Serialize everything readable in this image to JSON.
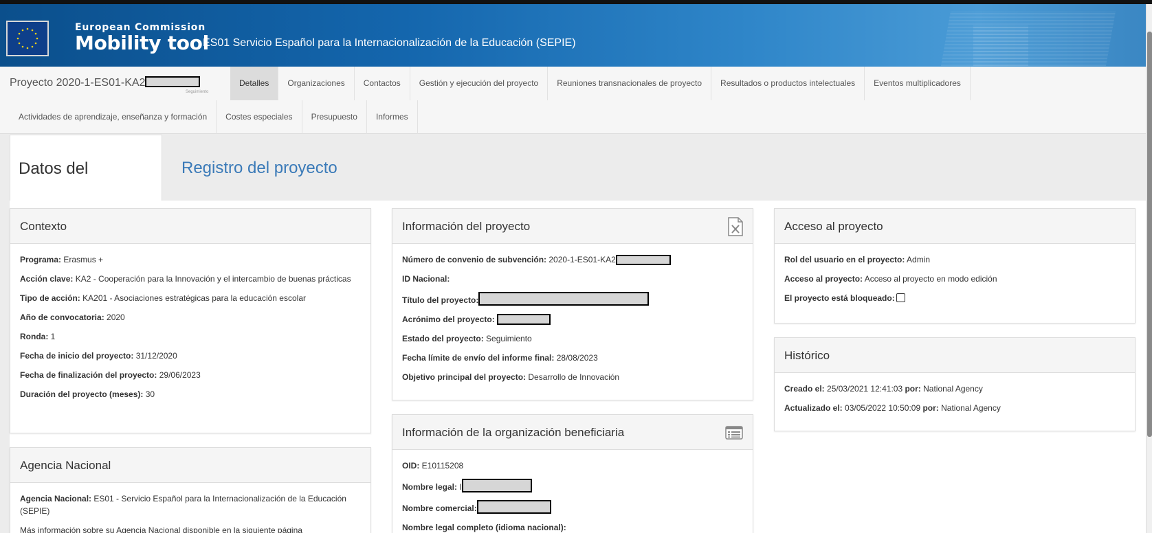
{
  "header": {
    "org_line1": "European Commission",
    "org_line2": "Mobility tool",
    "agency_title": "ES01 Servicio Español para la Internacionalización de la Educación (SEPIE)"
  },
  "project": {
    "id_prefix": "Proyecto 2020-1-ES01-KA2",
    "status_small": "Seguimiento"
  },
  "nav": {
    "row1": [
      "Detalles",
      "Organizaciones",
      "Contactos",
      "Gestión y ejecución del proyecto",
      "Reuniones transnacionales de proyecto",
      "Resultados o productos intelectuales",
      "Eventos multiplicadores"
    ],
    "row2": [
      "Actividades de aprendizaje, enseñanza y formación",
      "Costes especiales",
      "Presupuesto",
      "Informes"
    ]
  },
  "subtabs": {
    "active": "Datos del proyecto",
    "other": "Registro del proyecto"
  },
  "contexto": {
    "title": "Contexto",
    "programa_l": "Programa:",
    "programa_v": " Erasmus +",
    "accion_l": "Acción clave:",
    "accion_v": " KA2 - Cooperación para la Innovación y el intercambio de buenas prácticas",
    "tipo_l": "Tipo de acción:",
    "tipo_v": " KA201 - Asociaciones estratégicas para la educación escolar",
    "anio_l": "Año de convocatoria:",
    "anio_v": " 2020",
    "ronda_l": "Ronda:",
    "ronda_v": " 1",
    "inicio_l": "Fecha de inicio del proyecto:",
    "inicio_v": " 31/12/2020",
    "fin_l": "Fecha de finalización del proyecto:",
    "fin_v": " 29/06/2023",
    "dur_l": "Duración del proyecto (meses):",
    "dur_v": " 30"
  },
  "agencia": {
    "title": "Agencia Nacional",
    "ag_l": "Agencia Nacional:",
    "ag_v": " ES01 - Servicio Español para la Internacionalización de la Educación (SEPIE)",
    "more": "Más información sobre su Agencia Nacional disponible en la siguiente página"
  },
  "info": {
    "title": "Información del proyecto",
    "conv_l": "Número de convenio de subvención:",
    "conv_v": " 2020-1-ES01-KA2",
    "idn_l": "ID Nacional:",
    "tit_l": "Título del proyecto:",
    "acr_l": "Acrónimo del proyecto:",
    "est_l": "Estado del proyecto:",
    "est_v": " Seguimiento",
    "lim_l": "Fecha límite de envío del informe final:",
    "lim_v": " 28/08/2023",
    "obj_l": "Objetivo principal del proyecto:",
    "obj_v": " Desarrollo de Innovación"
  },
  "org": {
    "title": "Información de la organización beneficiaria",
    "oid_l": "OID:",
    "oid_v": " E10115208",
    "legal_l": "Nombre legal:",
    "legal_v": " I",
    "com_l": "Nombre comercial:",
    "full_l": "Nombre legal completo (idioma nacional):"
  },
  "acceso": {
    "title": "Acceso al proyecto",
    "rol_l": "Rol del usuario en el proyecto:",
    "rol_v": " Admin",
    "acc_l": "Acceso al proyecto:",
    "acc_v": " Acceso al proyecto en modo edición",
    "blq_l": "El proyecto está bloqueado:"
  },
  "historico": {
    "title": "Histórico",
    "cre_l": "Creado el:",
    "cre_v": " 25/03/2021 12:41:03",
    "cre_por": "por:",
    "cre_who": " National Agency",
    "act_l": "Actualizado el:",
    "act_v": " 03/05/2022 10:50:09",
    "act_por": "por:",
    "act_who": " National Agency"
  },
  "icons": {
    "export": "excel-icon",
    "list": "list-view-icon"
  }
}
